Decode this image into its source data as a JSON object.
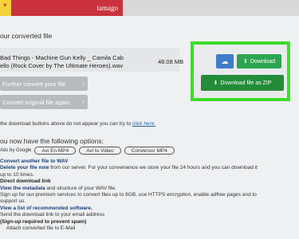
{
  "header": {
    "brand": "tamago"
  },
  "converted": {
    "title": "our converted file",
    "file_name_line1": "Bad Things - Machine Gun Kelly _ Camila Cab",
    "file_name_line2": "ello (Rock Cover by The Ultimate Heroes).wav",
    "file_size": "48.08 MB",
    "further_btn": "Further convert your file",
    "convert_again_btn": "Convert original file again"
  },
  "panel": {
    "download_label": "Download",
    "zip_label": "Download file as ZIP"
  },
  "hint": {
    "text": "the download buttons above do not appear you can try to",
    "link": "click here."
  },
  "options": {
    "title": "ou now have the following options:",
    "ads_label": "Ads by Google",
    "ad_pills": [
      "Avi En MP4",
      "Avi to Video",
      "Conversor MP4"
    ],
    "lines": [
      {
        "strong": "Convert another file to WAV",
        "rest": ""
      },
      {
        "strong": "Delete your file now",
        "rest": " from our server. For your convenience we store your file 24 hours and you can download it"
      },
      {
        "strong": "",
        "rest": "up to 10 times."
      },
      {
        "strong": "Direct download link",
        "rest": ""
      },
      {
        "strong": "View the metadata",
        "rest": " and structure of your WAV file."
      },
      {
        "strong": "",
        "rest": "Sign up for our premium services to convert files up to 8GB, use HTTPS encryption, enable adfree pages and to"
      },
      {
        "strong": "",
        "rest": "support us."
      },
      {
        "strong": "View a list of recommended software.",
        "rest": ""
      },
      {
        "strong": "",
        "rest": "Send the download link to your email address"
      },
      {
        "strong": "",
        "rest": "(Sign-up required to prevent spam)"
      },
      {
        "strong": "",
        "rest": "Attach converted file to E-Mail"
      }
    ]
  }
}
